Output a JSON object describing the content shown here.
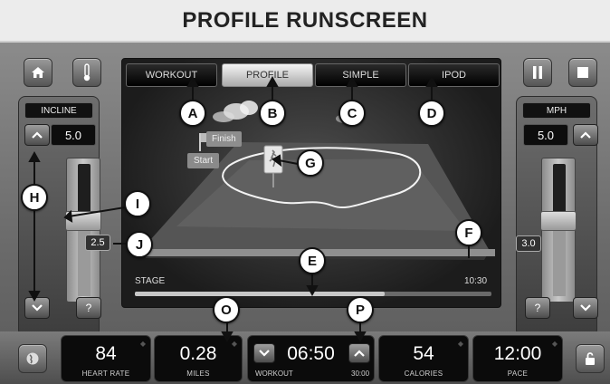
{
  "title": "PROFILE RUNSCREEN",
  "icons": {
    "home": "home-icon",
    "thermometer": "thermometer-icon",
    "pause": "pause-icon",
    "stop": "stop-icon",
    "help": "?",
    "globe": "globe-icon",
    "lock": "lock-icon"
  },
  "tabs": [
    {
      "label": "WORKOUT",
      "active": false
    },
    {
      "label": "PROFILE",
      "active": true
    },
    {
      "label": "SIMPLE",
      "active": false
    },
    {
      "label": "IPOD",
      "active": false
    }
  ],
  "incline": {
    "label": "INCLINE",
    "value": "5.0",
    "slider_tag": "2.5",
    "help": "?"
  },
  "speed": {
    "label": "MPH",
    "value": "5.0",
    "slider_tag": "3.0",
    "help": "?"
  },
  "profile": {
    "start_label": "Start",
    "finish_label": "Finish",
    "stage_label": "STAGE",
    "time_label": "10:30",
    "stage_progress": 0.7
  },
  "stats": {
    "heart_rate": {
      "value": "84",
      "label": "HEART RATE"
    },
    "miles": {
      "value": "0.28",
      "label": "MILES"
    },
    "workout": {
      "value": "06:50",
      "label": "WORKOUT",
      "target": "30:00"
    },
    "calories": {
      "value": "54",
      "label": "CALORIES"
    },
    "pace": {
      "value": "12:00",
      "label": "PACE"
    }
  },
  "callouts": [
    "A",
    "B",
    "C",
    "D",
    "E",
    "F",
    "G",
    "H",
    "I",
    "J",
    "O",
    "P"
  ],
  "colors": {
    "screen_bg": "#2a2a2a",
    "active_tab": "#e6e6e6",
    "callout_bg": "#ffffff"
  }
}
